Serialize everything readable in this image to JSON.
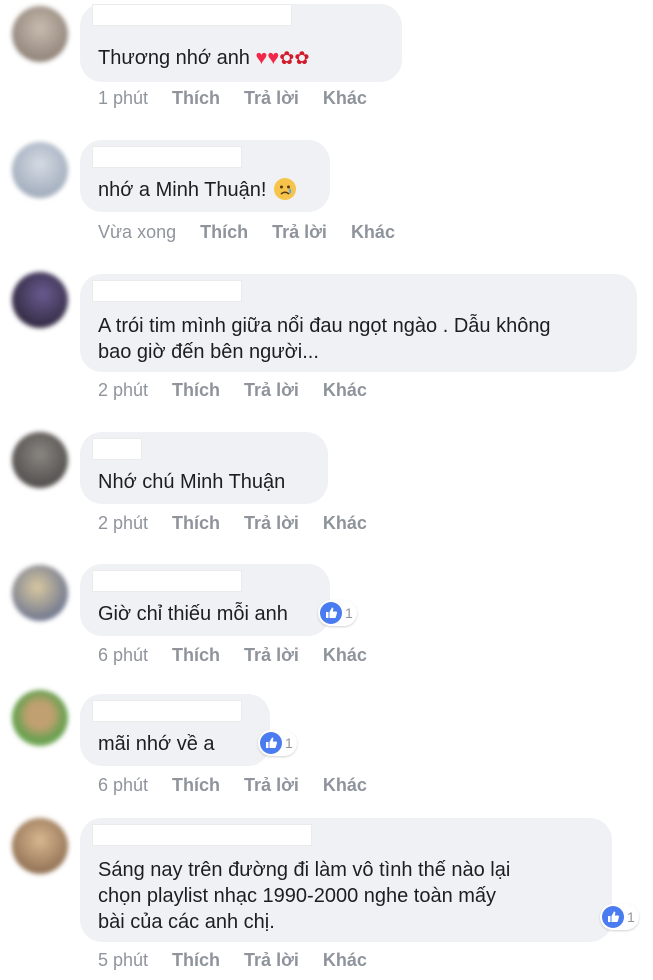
{
  "comments": [
    {
      "text": "Thương nhớ anh",
      "time": "1 phút",
      "like": "Thích",
      "reply": "Trả lời",
      "more": "Khác",
      "avatar_color": "#9a8f86"
    },
    {
      "text": "nhớ a Minh Thuận!",
      "time": "Vừa xong",
      "like": "Thích",
      "reply": "Trả lời",
      "more": "Khác",
      "avatar_color": "#a7b3c4"
    },
    {
      "text_line1": "A trói tim mình giữa nổi đau ngọt ngào . Dẫu không",
      "text_line2": "bao giờ đến bên người...",
      "time": "2 phút",
      "like": "Thích",
      "reply": "Trả lời",
      "more": "Khác",
      "avatar_color": "#3a2f4a"
    },
    {
      "text": "Nhớ chú Minh Thuận",
      "time": "2 phút",
      "like": "Thích",
      "reply": "Trả lời",
      "more": "Khác",
      "avatar_color": "#5c5a58"
    },
    {
      "text": "Giờ chỉ thiếu mỗi anh",
      "time": "6 phút",
      "like": "Thích",
      "reply": "Trả lời",
      "more": "Khác",
      "reaction_count": "1",
      "avatar_color": "#8f97b0"
    },
    {
      "text": "mãi nhớ về a",
      "time": "6 phút",
      "like": "Thích",
      "reply": "Trả lời",
      "more": "Khác",
      "reaction_count": "1",
      "avatar_color": "#7fa070"
    },
    {
      "text_line1": "Sáng nay trên đường đi làm vô tình thế nào lại",
      "text_line2": "chọn playlist nhạc 1990-2000 nghe toàn mấy",
      "text_line3": "bài của các anh chị.",
      "time": "5 phút",
      "like": "Thích",
      "reply": "Trả lời",
      "more": "Khác",
      "reaction_count": "1",
      "avatar_color": "#b09075"
    }
  ],
  "colors": {
    "bubble": "#f0f1f4",
    "action_text": "#90949c",
    "like_blue": "#4a7bf0",
    "heart": "#f02849"
  }
}
